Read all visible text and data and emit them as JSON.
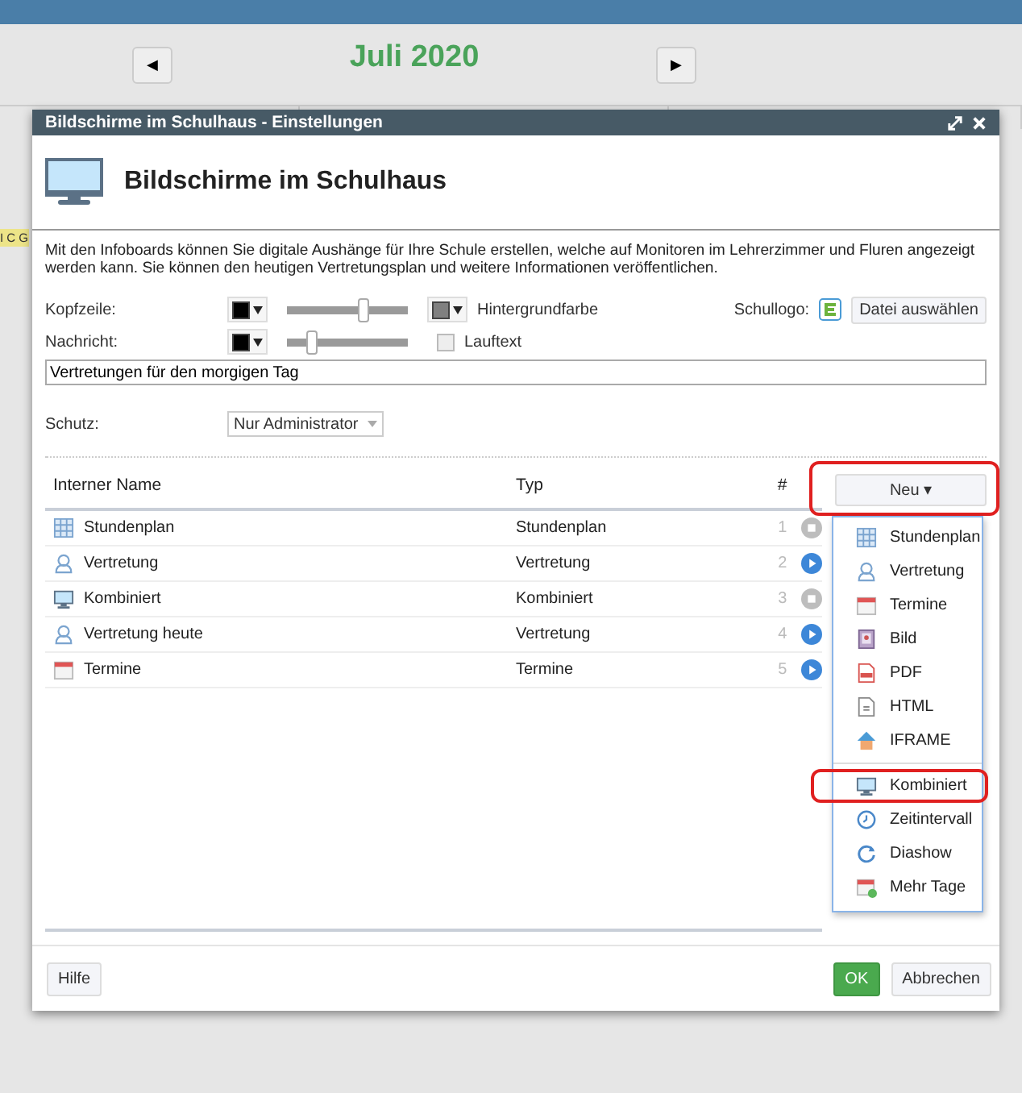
{
  "calendar": {
    "title": "Juli 2020",
    "prev": "◀",
    "next": "▶",
    "tag": "I C G"
  },
  "dialog": {
    "title": "Bildschirme im Schulhaus - Einstellungen",
    "heading": "Bildschirme im Schulhaus",
    "description": "Mit den Infoboards können Sie digitale Aushänge für Ihre Schule erstellen, welche auf Monitoren im Lehrerzimmer und Fluren angezeigt werden kann. Sie können den heutigen Vertretungsplan und weitere Informationen veröffentlichen.",
    "header_row": {
      "label": "Kopfzeile:",
      "level": 0.62,
      "bg_label": "Hintergrundfarbe",
      "logo_label": "Schullogo:",
      "file_button": "Datei auswählen"
    },
    "message_row": {
      "label": "Nachricht:",
      "level": 0.2,
      "marquee_label": "Lauftext",
      "marquee_checked": false,
      "value": "Vertretungen für den morgigen Tag"
    },
    "protection": {
      "label": "Schutz:",
      "value": "Nur Administrator"
    },
    "table": {
      "columns": [
        "Interner Name",
        "Typ",
        "#"
      ],
      "rows": [
        {
          "kind": "grid",
          "name": "Stundenplan",
          "type": "Stundenplan",
          "index": "1",
          "playing": false
        },
        {
          "kind": "person",
          "name": "Vertretung",
          "type": "Vertretung",
          "index": "2",
          "playing": true
        },
        {
          "kind": "monitor",
          "name": "Kombiniert",
          "type": "Kombiniert",
          "index": "3",
          "playing": false
        },
        {
          "kind": "person",
          "name": "Vertretung heute",
          "type": "Vertretung",
          "index": "4",
          "playing": true
        },
        {
          "kind": "calendar",
          "name": "Termine",
          "type": "Termine",
          "index": "5",
          "playing": true
        }
      ]
    },
    "new_button": {
      "label": "Neu ▾",
      "highlighted": true
    },
    "menu_groups": [
      [
        {
          "kind": "grid",
          "label": "Stundenplan",
          "highlighted": false
        },
        {
          "kind": "person",
          "label": "Vertretung",
          "highlighted": false
        },
        {
          "kind": "calendar",
          "label": "Termine",
          "highlighted": false
        },
        {
          "kind": "image",
          "label": "Bild",
          "highlighted": false
        },
        {
          "kind": "pdf",
          "label": "PDF",
          "highlighted": false
        },
        {
          "kind": "document",
          "label": "HTML",
          "highlighted": false
        },
        {
          "kind": "house",
          "label": "IFRAME",
          "highlighted": false
        }
      ],
      [
        {
          "kind": "monitor",
          "label": "Kombiniert",
          "highlighted": true
        },
        {
          "kind": "clock",
          "label": "Zeitintervall",
          "highlighted": false
        },
        {
          "kind": "cycle",
          "label": "Diashow",
          "highlighted": false
        },
        {
          "kind": "calendar-plus",
          "label": "Mehr Tage",
          "highlighted": false
        }
      ]
    ],
    "buttons": {
      "help": "Hilfe",
      "ok": "OK",
      "cancel": "Abbrechen"
    }
  }
}
